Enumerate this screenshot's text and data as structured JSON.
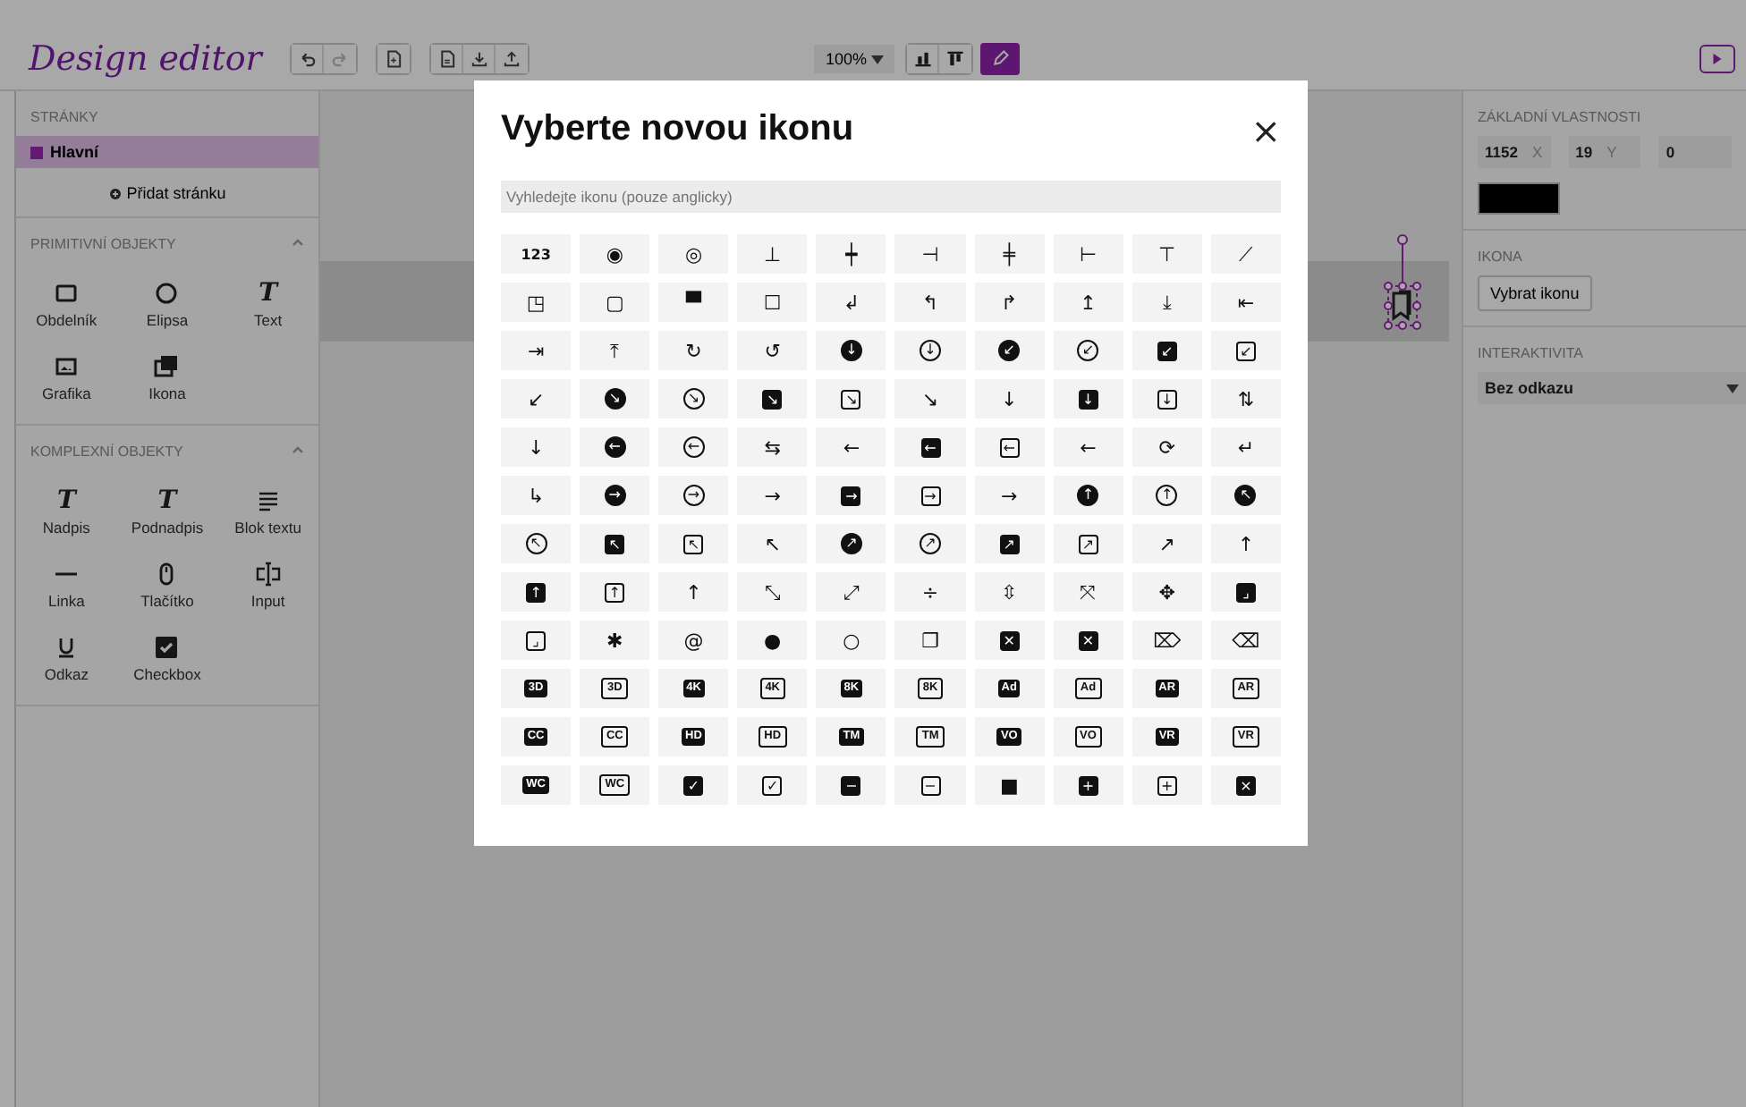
{
  "app": {
    "title": "Design editor"
  },
  "toolbar": {
    "history": [
      {
        "kind": "undo",
        "disabled": false
      },
      {
        "kind": "redo",
        "disabled": true
      }
    ],
    "zoom": "100%"
  },
  "sidebar": {
    "pages_heading": "STRÁNKY",
    "pages": [
      {
        "label": "Hlavní",
        "selected": true
      }
    ],
    "add_page": "Přidat stránku",
    "sections": [
      {
        "title": "PRIMITIVNÍ OBJEKTY",
        "expanded": true,
        "tools": [
          {
            "label": "Obdelník"
          },
          {
            "label": "Elipsa"
          },
          {
            "label": "Text",
            "glyph": "T"
          },
          {
            "label": "Grafika"
          },
          {
            "label": "Ikona"
          }
        ]
      },
      {
        "title": "KOMPLEXNÍ OBJEKTY",
        "expanded": true,
        "tools": [
          {
            "label": "Nadpis",
            "glyph": "T"
          },
          {
            "label": "Podnadpis",
            "glyph": "T"
          },
          {
            "label": "Blok textu"
          },
          {
            "label": "Linka"
          },
          {
            "label": "Tlačítko"
          },
          {
            "label": "Input"
          },
          {
            "label": "Odkaz"
          },
          {
            "label": "Checkbox"
          }
        ]
      }
    ]
  },
  "properties": {
    "basic": {
      "title": "ZÁKLADNÍ VLASTNOSTI",
      "fields": [
        {
          "value": "1152",
          "label": "X"
        },
        {
          "value": "19",
          "label": "Y"
        },
        {
          "value": "0"
        }
      ]
    },
    "icon": {
      "title": "IKONA",
      "button": "Vybrat ikonu"
    },
    "interactivity": {
      "title": "INTERAKTIVITA",
      "value": "Bez odkazu"
    }
  },
  "dialog": {
    "title": "Vyberte novou ikonu",
    "close": "×",
    "search": {
      "placeholder": "Vyhledejte ikonu (pouze anglicky)"
    },
    "icons": [
      {
        "kind": "plain",
        "glyph": "123"
      },
      {
        "kind": "plain",
        "glyph": "◉"
      },
      {
        "kind": "plain",
        "glyph": "◎"
      },
      {
        "kind": "plain",
        "glyph": "⊥"
      },
      {
        "kind": "plain",
        "glyph": "┿"
      },
      {
        "kind": "plain",
        "glyph": "⊣"
      },
      {
        "kind": "plain",
        "glyph": "╪"
      },
      {
        "kind": "plain",
        "glyph": "⊢"
      },
      {
        "kind": "plain",
        "glyph": "⊤"
      },
      {
        "kind": "plain",
        "glyph": "⟋"
      },
      {
        "kind": "plain",
        "glyph": "◳"
      },
      {
        "kind": "plain",
        "glyph": "▢"
      },
      {
        "kind": "plain",
        "glyph": "▀"
      },
      {
        "kind": "plain",
        "glyph": "☐"
      },
      {
        "kind": "plain",
        "glyph": "↲"
      },
      {
        "kind": "plain",
        "glyph": "↰"
      },
      {
        "kind": "plain",
        "glyph": "↱"
      },
      {
        "kind": "plain",
        "glyph": "↥"
      },
      {
        "kind": "plain",
        "glyph": "⤓"
      },
      {
        "kind": "plain",
        "glyph": "⇤"
      },
      {
        "kind": "plain",
        "glyph": "⇥"
      },
      {
        "kind": "plain",
        "glyph": "⤒"
      },
      {
        "kind": "plain",
        "glyph": "↻"
      },
      {
        "kind": "plain",
        "glyph": "↺"
      },
      {
        "kind": "disc",
        "glyph": "↓"
      },
      {
        "kind": "ring",
        "glyph": "↓"
      },
      {
        "kind": "disc",
        "glyph": "↙"
      },
      {
        "kind": "ring",
        "glyph": "↙"
      },
      {
        "kind": "tile",
        "glyph": "↙"
      },
      {
        "kind": "frame",
        "glyph": "↙"
      },
      {
        "kind": "plain",
        "glyph": "↙"
      },
      {
        "kind": "disc",
        "glyph": "↘"
      },
      {
        "kind": "ring",
        "glyph": "↘"
      },
      {
        "kind": "tile",
        "glyph": "↘"
      },
      {
        "kind": "frame",
        "glyph": "↘"
      },
      {
        "kind": "plain",
        "glyph": "↘"
      },
      {
        "kind": "plain",
        "glyph": "↓"
      },
      {
        "kind": "tile",
        "glyph": "↓"
      },
      {
        "kind": "frame",
        "glyph": "↓"
      },
      {
        "kind": "plain",
        "glyph": "⇅"
      },
      {
        "kind": "plain",
        "glyph": "↓"
      },
      {
        "kind": "disc",
        "glyph": "←"
      },
      {
        "kind": "ring",
        "glyph": "←"
      },
      {
        "kind": "plain",
        "glyph": "⇆"
      },
      {
        "kind": "plain",
        "glyph": "←"
      },
      {
        "kind": "tile",
        "glyph": "←"
      },
      {
        "kind": "frame",
        "glyph": "←"
      },
      {
        "kind": "plain",
        "glyph": "←"
      },
      {
        "kind": "plain",
        "glyph": "⟳"
      },
      {
        "kind": "plain",
        "glyph": "↵"
      },
      {
        "kind": "plain",
        "glyph": "↳"
      },
      {
        "kind": "disc",
        "glyph": "→"
      },
      {
        "kind": "ring",
        "glyph": "→"
      },
      {
        "kind": "plain",
        "glyph": "→"
      },
      {
        "kind": "tile",
        "glyph": "→"
      },
      {
        "kind": "frame",
        "glyph": "→"
      },
      {
        "kind": "plain",
        "glyph": "→"
      },
      {
        "kind": "disc",
        "glyph": "↑"
      },
      {
        "kind": "ring",
        "glyph": "↑"
      },
      {
        "kind": "disc",
        "glyph": "↖"
      },
      {
        "kind": "ring",
        "glyph": "↖"
      },
      {
        "kind": "tile",
        "glyph": "↖"
      },
      {
        "kind": "frame",
        "glyph": "↖"
      },
      {
        "kind": "plain",
        "glyph": "↖"
      },
      {
        "kind": "disc",
        "glyph": "↗"
      },
      {
        "kind": "ring",
        "glyph": "↗"
      },
      {
        "kind": "tile",
        "glyph": "↗"
      },
      {
        "kind": "frame",
        "glyph": "↗"
      },
      {
        "kind": "plain",
        "glyph": "↗"
      },
      {
        "kind": "plain",
        "glyph": "↑"
      },
      {
        "kind": "tile",
        "glyph": "↑"
      },
      {
        "kind": "frame",
        "glyph": "↑"
      },
      {
        "kind": "plain",
        "glyph": "↑"
      },
      {
        "kind": "plain",
        "glyph": "⤡"
      },
      {
        "kind": "plain",
        "glyph": "⤢"
      },
      {
        "kind": "plain",
        "glyph": "÷"
      },
      {
        "kind": "plain",
        "glyph": "⇳"
      },
      {
        "kind": "plain",
        "glyph": "⤧"
      },
      {
        "kind": "plain",
        "glyph": "✥"
      },
      {
        "kind": "tile",
        "glyph": "⌟"
      },
      {
        "kind": "frame",
        "glyph": "⌟"
      },
      {
        "kind": "plain",
        "glyph": "✱"
      },
      {
        "kind": "plain",
        "glyph": "@"
      },
      {
        "kind": "plain",
        "glyph": "●"
      },
      {
        "kind": "plain",
        "glyph": "○"
      },
      {
        "kind": "plain",
        "glyph": "❐"
      },
      {
        "kind": "tile",
        "glyph": "✕"
      },
      {
        "kind": "tile",
        "glyph": "✕"
      },
      {
        "kind": "plain",
        "glyph": "⌦"
      },
      {
        "kind": "plain",
        "glyph": "⌫"
      },
      {
        "kind": "badge",
        "glyph": "3D"
      },
      {
        "kind": "hollow",
        "glyph": "3D"
      },
      {
        "kind": "badge",
        "glyph": "4K"
      },
      {
        "kind": "hollow",
        "glyph": "4K"
      },
      {
        "kind": "badge",
        "glyph": "8K"
      },
      {
        "kind": "hollow",
        "glyph": "8K"
      },
      {
        "kind": "badge",
        "glyph": "Ad"
      },
      {
        "kind": "hollow",
        "glyph": "Ad"
      },
      {
        "kind": "badge",
        "glyph": "AR"
      },
      {
        "kind": "hollow",
        "glyph": "AR"
      },
      {
        "kind": "badge",
        "glyph": "CC"
      },
      {
        "kind": "hollow",
        "glyph": "CC"
      },
      {
        "kind": "badge",
        "glyph": "HD"
      },
      {
        "kind": "hollow",
        "glyph": "HD"
      },
      {
        "kind": "badge",
        "glyph": "TM"
      },
      {
        "kind": "hollow",
        "glyph": "TM"
      },
      {
        "kind": "badge",
        "glyph": "VO"
      },
      {
        "kind": "hollow",
        "glyph": "VO"
      },
      {
        "kind": "badge",
        "glyph": "VR"
      },
      {
        "kind": "hollow",
        "glyph": "VR"
      },
      {
        "kind": "badge",
        "glyph": "WC"
      },
      {
        "kind": "hollow",
        "glyph": "WC"
      },
      {
        "kind": "tile",
        "glyph": "✓"
      },
      {
        "kind": "frame",
        "glyph": "✓"
      },
      {
        "kind": "tile",
        "glyph": "−"
      },
      {
        "kind": "frame",
        "glyph": "−"
      },
      {
        "kind": "plain",
        "glyph": "■"
      },
      {
        "kind": "tile",
        "glyph": "+"
      },
      {
        "kind": "frame",
        "glyph": "+"
      },
      {
        "kind": "tile",
        "glyph": "×"
      }
    ]
  }
}
